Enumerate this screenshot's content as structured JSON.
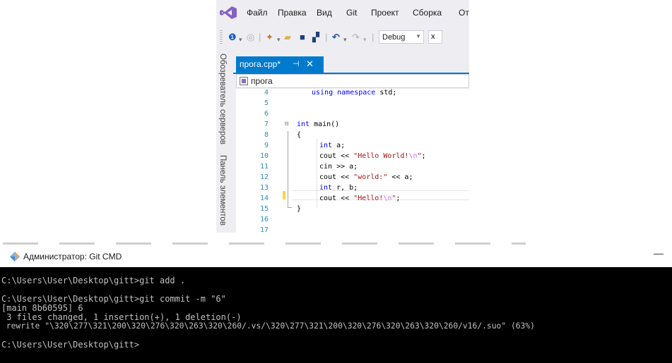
{
  "vs": {
    "menu": [
      "Файл",
      "Правка",
      "Вид",
      "Git",
      "Проект",
      "Сборка",
      "От"
    ],
    "config": "Debug",
    "platform_partial": "x",
    "side_panels": [
      "Обозреватель серверов",
      "Панель элементов"
    ],
    "tab": {
      "name": "прога.cpp*",
      "pin": "⊣",
      "close": "✕"
    },
    "nav_scope": "прога",
    "code_lines": [
      {
        "n": "4",
        "text": "using namespace std;"
      },
      {
        "n": "5",
        "text": ""
      },
      {
        "n": "6",
        "text": ""
      },
      {
        "n": "7",
        "text": "int main()"
      },
      {
        "n": "8",
        "text": "{"
      },
      {
        "n": "9",
        "text": "int a;"
      },
      {
        "n": "10",
        "text": "cout << \"Hello World!\\n\";"
      },
      {
        "n": "11",
        "text": "cin >> a;"
      },
      {
        "n": "12",
        "text": "cout << \"world:\" << a;"
      },
      {
        "n": "13",
        "text": "int r, b;"
      },
      {
        "n": "14",
        "text": "cout << \"Hello!\\n\";"
      },
      {
        "n": "15",
        "text": "}"
      },
      {
        "n": "16",
        "text": ""
      },
      {
        "n": "17",
        "text": ""
      }
    ],
    "tokens": {
      "using": "using",
      "namespace": "namespace",
      "std": " std;",
      "int": "int",
      "main": " main()",
      "cout": "cout << ",
      "cin": "cin >> a;",
      "hello_world": "\"Hello World!",
      "esc_n": "\\n",
      "quote_semi": "\";",
      "world_str": "\"world:\"",
      "world_rest": " << a;",
      "a_decl": " a;",
      "rb_decl": " r, b;",
      "hello_str": "\"Hello!",
      "open_brace": "{",
      "close_brace": "}"
    },
    "current_line": "14"
  },
  "cmd": {
    "title": "Администратор: Git CMD",
    "minimize": "—",
    "lines": [
      "C:\\Users\\User\\Desktop\\gitt>git add .",
      "C:\\Users\\User\\Desktop\\gitt>git commit -m \"6\"",
      "[main 8b60595] 6",
      " 3 files changed, 1 insertion(+), 1 deletion(-)",
      " rewrite \"\\320\\277\\321\\200\\320\\276\\320\\263\\320\\260/.vs/\\320\\277\\321\\200\\320\\276\\320\\263\\320\\260/v16/.suo\" (63%)",
      "C:\\Users\\User\\Desktop\\gitt>"
    ]
  },
  "colors": {
    "vs_accent": "#007acc",
    "keyword": "#0000ff",
    "string": "#a31515",
    "escape": "#b776fb",
    "line_number": "#2b91af",
    "terminal_bg": "#000000",
    "terminal_fg": "#c0c0c0"
  }
}
